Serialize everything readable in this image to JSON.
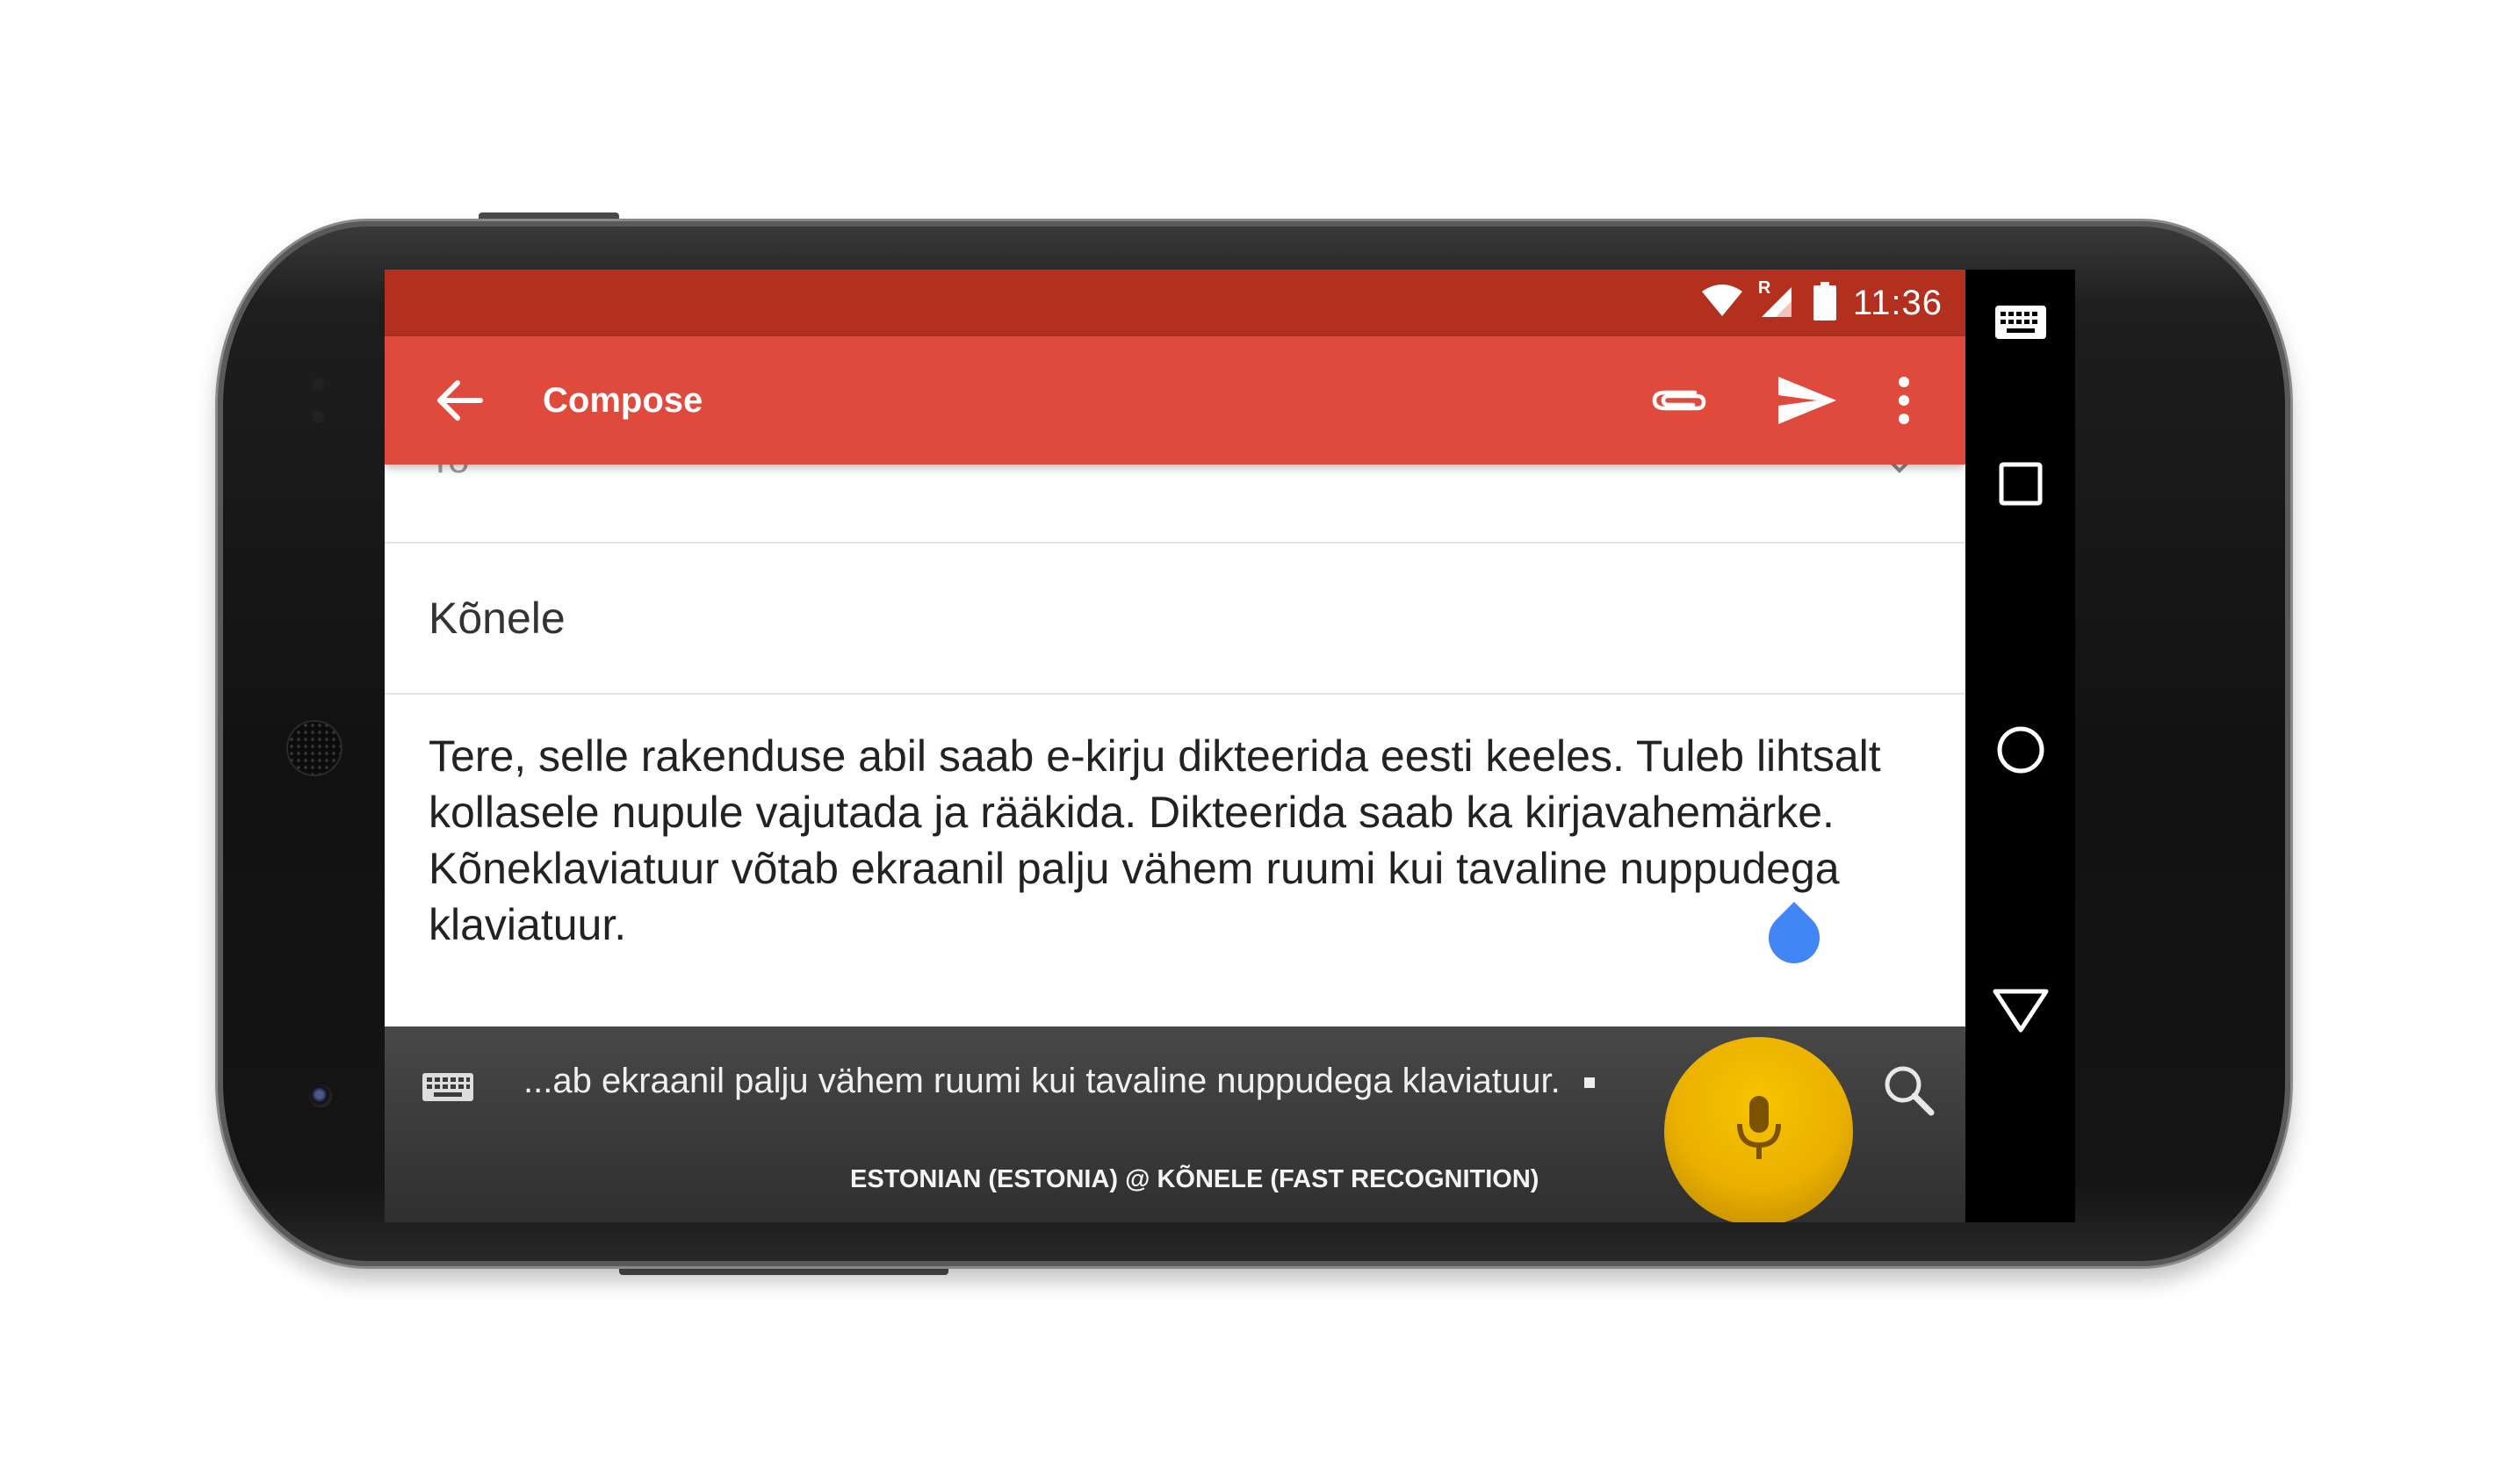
{
  "status_bar": {
    "time": "11:36",
    "icons": [
      "wifi-icon",
      "signal-roaming-icon",
      "battery-icon"
    ],
    "roaming_label": "R"
  },
  "app_bar": {
    "title": "Compose",
    "back_icon": "arrow-back-icon",
    "actions": [
      "attach-icon",
      "send-icon",
      "more-vert-icon"
    ]
  },
  "compose": {
    "to_label": "To",
    "subject": "Kõnele",
    "body": "Tere, selle rakenduse abil saab e-kirju dikteerida eesti keeles. Tuleb lihtsalt kollasele nupule vajutada ja rääkida. Dikteerida saab ka kirjavahemärke. Kõneklaviatuur võtab ekraanil palju vähem ruumi kui tavaline nuppudega klaviatuur."
  },
  "ime": {
    "transcript": "...ab ekraanil palju vähem ruumi kui tavaline nuppudega klaviatuur.",
    "language": "ESTONIAN (ESTONIA) @ KÕNELE (FAST RECOGNITION)",
    "keyboard_icon": "keyboard-icon",
    "mic_icon": "mic-icon",
    "search_icon": "search-icon"
  },
  "navigation": [
    "keyboard-switch-icon",
    "recents-icon",
    "home-icon",
    "back-triangle-icon"
  ],
  "colors": {
    "status_bar": "#b3301f",
    "app_bar": "#e04a3c",
    "mic_button": "#eab000",
    "cursor_handle": "#4285f4"
  }
}
